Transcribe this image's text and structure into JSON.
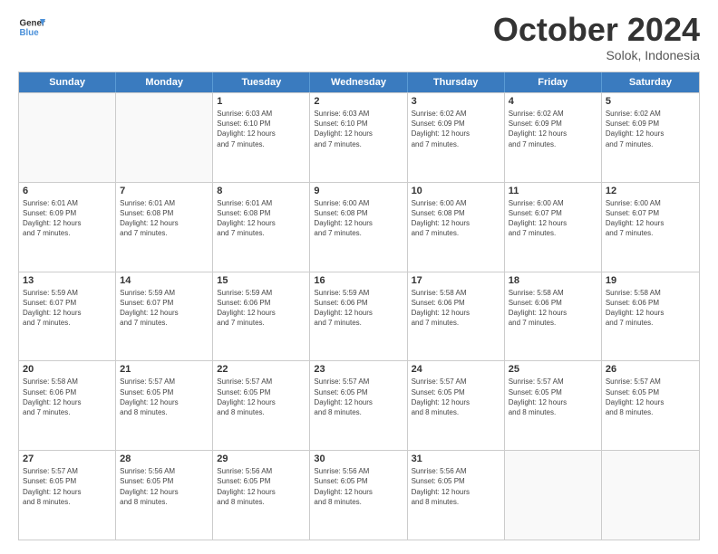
{
  "logo": {
    "line1": "General",
    "line2": "Blue"
  },
  "title": "October 2024",
  "location": "Solok, Indonesia",
  "days_of_week": [
    "Sunday",
    "Monday",
    "Tuesday",
    "Wednesday",
    "Thursday",
    "Friday",
    "Saturday"
  ],
  "weeks": [
    [
      {
        "num": "",
        "info": ""
      },
      {
        "num": "",
        "info": ""
      },
      {
        "num": "1",
        "info": "Sunrise: 6:03 AM\nSunset: 6:10 PM\nDaylight: 12 hours\nand 7 minutes."
      },
      {
        "num": "2",
        "info": "Sunrise: 6:03 AM\nSunset: 6:10 PM\nDaylight: 12 hours\nand 7 minutes."
      },
      {
        "num": "3",
        "info": "Sunrise: 6:02 AM\nSunset: 6:09 PM\nDaylight: 12 hours\nand 7 minutes."
      },
      {
        "num": "4",
        "info": "Sunrise: 6:02 AM\nSunset: 6:09 PM\nDaylight: 12 hours\nand 7 minutes."
      },
      {
        "num": "5",
        "info": "Sunrise: 6:02 AM\nSunset: 6:09 PM\nDaylight: 12 hours\nand 7 minutes."
      }
    ],
    [
      {
        "num": "6",
        "info": "Sunrise: 6:01 AM\nSunset: 6:09 PM\nDaylight: 12 hours\nand 7 minutes."
      },
      {
        "num": "7",
        "info": "Sunrise: 6:01 AM\nSunset: 6:08 PM\nDaylight: 12 hours\nand 7 minutes."
      },
      {
        "num": "8",
        "info": "Sunrise: 6:01 AM\nSunset: 6:08 PM\nDaylight: 12 hours\nand 7 minutes."
      },
      {
        "num": "9",
        "info": "Sunrise: 6:00 AM\nSunset: 6:08 PM\nDaylight: 12 hours\nand 7 minutes."
      },
      {
        "num": "10",
        "info": "Sunrise: 6:00 AM\nSunset: 6:08 PM\nDaylight: 12 hours\nand 7 minutes."
      },
      {
        "num": "11",
        "info": "Sunrise: 6:00 AM\nSunset: 6:07 PM\nDaylight: 12 hours\nand 7 minutes."
      },
      {
        "num": "12",
        "info": "Sunrise: 6:00 AM\nSunset: 6:07 PM\nDaylight: 12 hours\nand 7 minutes."
      }
    ],
    [
      {
        "num": "13",
        "info": "Sunrise: 5:59 AM\nSunset: 6:07 PM\nDaylight: 12 hours\nand 7 minutes."
      },
      {
        "num": "14",
        "info": "Sunrise: 5:59 AM\nSunset: 6:07 PM\nDaylight: 12 hours\nand 7 minutes."
      },
      {
        "num": "15",
        "info": "Sunrise: 5:59 AM\nSunset: 6:06 PM\nDaylight: 12 hours\nand 7 minutes."
      },
      {
        "num": "16",
        "info": "Sunrise: 5:59 AM\nSunset: 6:06 PM\nDaylight: 12 hours\nand 7 minutes."
      },
      {
        "num": "17",
        "info": "Sunrise: 5:58 AM\nSunset: 6:06 PM\nDaylight: 12 hours\nand 7 minutes."
      },
      {
        "num": "18",
        "info": "Sunrise: 5:58 AM\nSunset: 6:06 PM\nDaylight: 12 hours\nand 7 minutes."
      },
      {
        "num": "19",
        "info": "Sunrise: 5:58 AM\nSunset: 6:06 PM\nDaylight: 12 hours\nand 7 minutes."
      }
    ],
    [
      {
        "num": "20",
        "info": "Sunrise: 5:58 AM\nSunset: 6:06 PM\nDaylight: 12 hours\nand 7 minutes."
      },
      {
        "num": "21",
        "info": "Sunrise: 5:57 AM\nSunset: 6:05 PM\nDaylight: 12 hours\nand 8 minutes."
      },
      {
        "num": "22",
        "info": "Sunrise: 5:57 AM\nSunset: 6:05 PM\nDaylight: 12 hours\nand 8 minutes."
      },
      {
        "num": "23",
        "info": "Sunrise: 5:57 AM\nSunset: 6:05 PM\nDaylight: 12 hours\nand 8 minutes."
      },
      {
        "num": "24",
        "info": "Sunrise: 5:57 AM\nSunset: 6:05 PM\nDaylight: 12 hours\nand 8 minutes."
      },
      {
        "num": "25",
        "info": "Sunrise: 5:57 AM\nSunset: 6:05 PM\nDaylight: 12 hours\nand 8 minutes."
      },
      {
        "num": "26",
        "info": "Sunrise: 5:57 AM\nSunset: 6:05 PM\nDaylight: 12 hours\nand 8 minutes."
      }
    ],
    [
      {
        "num": "27",
        "info": "Sunrise: 5:57 AM\nSunset: 6:05 PM\nDaylight: 12 hours\nand 8 minutes."
      },
      {
        "num": "28",
        "info": "Sunrise: 5:56 AM\nSunset: 6:05 PM\nDaylight: 12 hours\nand 8 minutes."
      },
      {
        "num": "29",
        "info": "Sunrise: 5:56 AM\nSunset: 6:05 PM\nDaylight: 12 hours\nand 8 minutes."
      },
      {
        "num": "30",
        "info": "Sunrise: 5:56 AM\nSunset: 6:05 PM\nDaylight: 12 hours\nand 8 minutes."
      },
      {
        "num": "31",
        "info": "Sunrise: 5:56 AM\nSunset: 6:05 PM\nDaylight: 12 hours\nand 8 minutes."
      },
      {
        "num": "",
        "info": ""
      },
      {
        "num": "",
        "info": ""
      }
    ]
  ]
}
